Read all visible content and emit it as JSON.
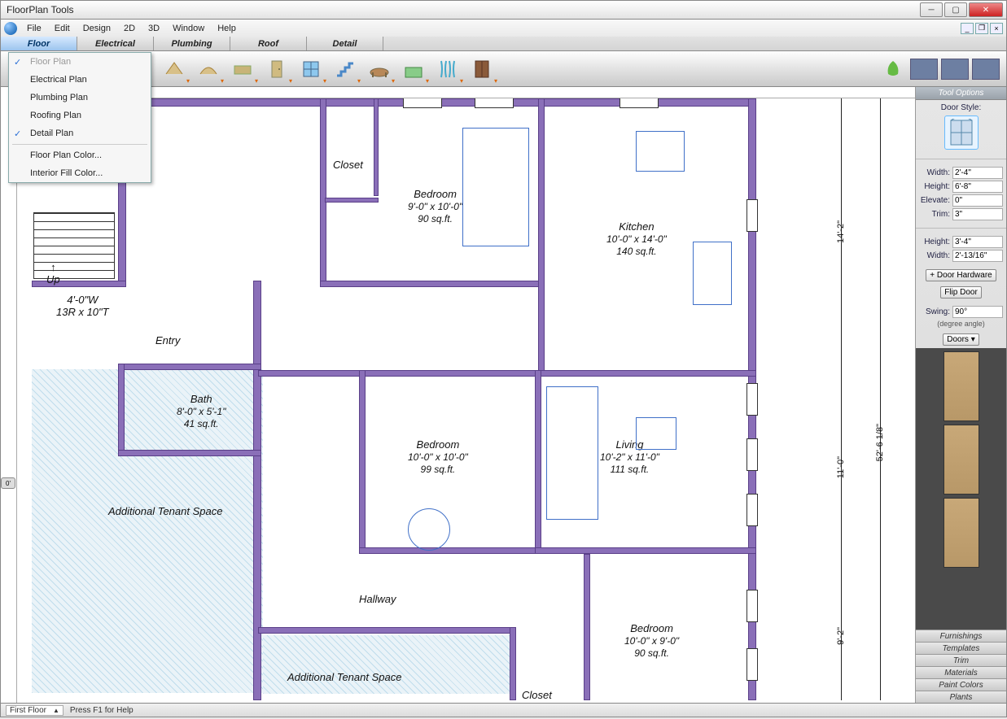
{
  "window_title": "FloorPlan Tools",
  "menubar": [
    "File",
    "Edit",
    "Design",
    "2D",
    "3D",
    "Window",
    "Help"
  ],
  "design_tabs": [
    "Floor",
    "Electrical",
    "Plumbing",
    "Roof",
    "Detail"
  ],
  "floor_menu": {
    "items": [
      "Floor Plan",
      "Electrical Plan",
      "Plumbing Plan",
      "Roofing Plan",
      "Detail Plan",
      "Floor Plan Color...",
      "Interior Fill Color..."
    ]
  },
  "rooms": {
    "closet": {
      "name": "Closet"
    },
    "bedroom1": {
      "name": "Bedroom",
      "dim": "9'-0\" x 10'-0\"",
      "area": "90 sq.ft."
    },
    "kitchen": {
      "name": "Kitchen",
      "dim": "10'-0\" x 14'-0\"",
      "area": "140 sq.ft."
    },
    "entry": {
      "name": "Entry"
    },
    "bath": {
      "name": "Bath",
      "dim": "8'-0\" x 5'-1\"",
      "area": "41 sq.ft."
    },
    "bedroom2": {
      "name": "Bedroom",
      "dim": "10'-0\" x 10'-0\"",
      "area": "99 sq.ft."
    },
    "living": {
      "name": "Living",
      "dim": "10'-2\" x 11'-0\"",
      "area": "111 sq.ft."
    },
    "hallway": {
      "name": "Hallway"
    },
    "bedroom3": {
      "name": "Bedroom",
      "dim": "10'-0\" x 9'-0\"",
      "area": "90 sq.ft."
    },
    "closet2": {
      "name": "Closet"
    },
    "tenant1": {
      "name": "Additional Tenant Space"
    },
    "tenant2": {
      "name": "Additional Tenant Space"
    },
    "stairs": {
      "label": "Up",
      "dim": "4'-0\"W",
      "riser": "13R x 10\"T"
    }
  },
  "dims": {
    "right1": "14'-2\"",
    "right2": "11'-0\"",
    "right3": "9'-2\"",
    "far_right": "52'-6 1/8\""
  },
  "tool_options": {
    "header": "Tool Options",
    "style_label": "Door Style:",
    "width_label": "Width:",
    "width_val": "2'-4\"",
    "height_label": "Height:",
    "height_val": "6'-8\"",
    "elevate_label": "Elevate:",
    "elevate_val": "0\"",
    "trim_label": "Trim:",
    "trim_val": "3\"",
    "h2_label": "Height:",
    "h2_val": "3'-4\"",
    "w2_label": "Width:",
    "w2_val": "2'-13/16\"",
    "door_hw": "Door Hardware",
    "flip": "Flip Door",
    "swing_label": "Swing:",
    "swing_val": "90°",
    "swing_note": "(degree angle)",
    "doors_btn": "Doors ▾"
  },
  "accordion": [
    "Furnishings",
    "Templates",
    "Trim",
    "Materials",
    "Paint Colors",
    "Plants"
  ],
  "statusbar": {
    "floor": "First Floor",
    "help": "Press F1 for Help"
  },
  "ruler_mark": "0'"
}
